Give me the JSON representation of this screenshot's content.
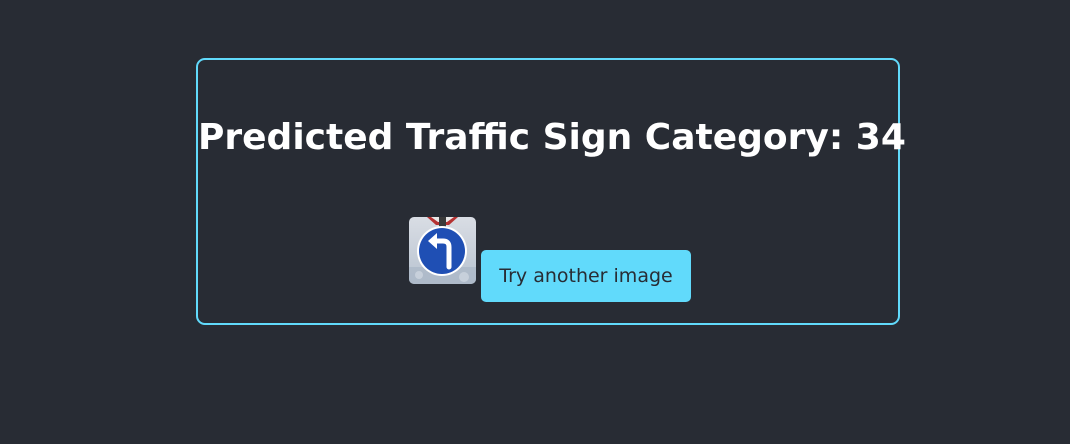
{
  "result": {
    "title": "Predicted Traffic Sign Category: 34",
    "button_label": "Try another image",
    "image_content": "traffic-sign-turn-left-ahead-icon"
  },
  "colors": {
    "background": "#282c34",
    "accent": "#61dafb",
    "title_text": "#ffffff"
  }
}
